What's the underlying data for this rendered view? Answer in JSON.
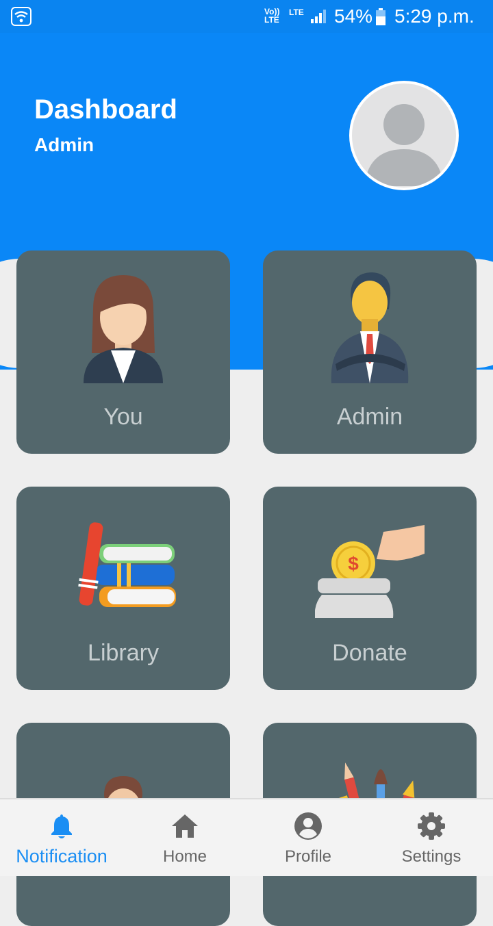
{
  "status_bar": {
    "net_line1": "Vo))",
    "net_line2": "LTE",
    "lte_label": "LTE",
    "battery": "54%",
    "time": "5:29 p.m."
  },
  "header": {
    "title": "Dashboard",
    "subtitle": "Admin"
  },
  "cards": [
    {
      "label": "You",
      "icon": "woman-icon"
    },
    {
      "label": "Admin",
      "icon": "businessman-icon"
    },
    {
      "label": "Library",
      "icon": "books-icon"
    },
    {
      "label": "Donate",
      "icon": "donate-coin-icon"
    },
    {
      "label": "",
      "icon": "group-icon"
    },
    {
      "label": "",
      "icon": "art-tools-icon"
    }
  ],
  "bottom_nav": {
    "items": [
      {
        "label": "Notification",
        "icon": "bell-icon",
        "active": true
      },
      {
        "label": "Home",
        "icon": "home-icon",
        "active": false
      },
      {
        "label": "Profile",
        "icon": "account-circle-icon",
        "active": false
      },
      {
        "label": "Settings",
        "icon": "gear-icon",
        "active": false
      }
    ]
  },
  "colors": {
    "primary": "#0a87f7",
    "card": "#53676c",
    "card_label": "#c8cfd1",
    "nav_active": "#1a8ef3",
    "nav_inactive": "#666666"
  }
}
